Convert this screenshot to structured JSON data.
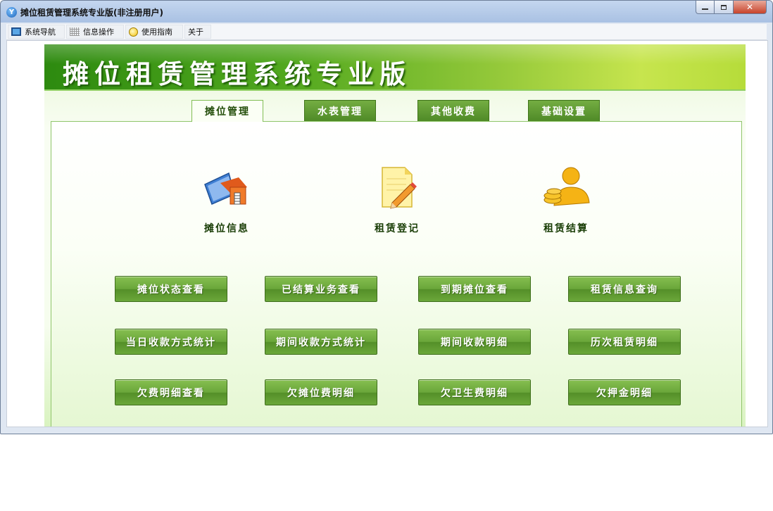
{
  "window": {
    "title": "摊位租赁管理系统专业版(非注册用户)",
    "controls": {
      "close": "✕"
    }
  },
  "menu": [
    {
      "label": "系统导航",
      "icon": "monitor-icon"
    },
    {
      "label": "信息操作",
      "icon": "grid-icon"
    },
    {
      "label": "使用指南",
      "icon": "lightbulb-icon"
    },
    {
      "label": "关于",
      "icon": ""
    }
  ],
  "banner": {
    "title": "摊位租赁管理系统专业版"
  },
  "tabs": [
    {
      "label": "摊位管理",
      "active": true
    },
    {
      "label": "水表管理",
      "active": false
    },
    {
      "label": "其他收费",
      "active": false
    },
    {
      "label": "基础设置",
      "active": false
    }
  ],
  "features": [
    {
      "label": "摊位信息",
      "icon": "house-book-icon"
    },
    {
      "label": "租赁登记",
      "icon": "notepad-pencil-icon"
    },
    {
      "label": "租赁结算",
      "icon": "person-coins-icon"
    }
  ],
  "buttons": [
    [
      "摊位状态查看",
      "已结算业务查看",
      "到期摊位查看",
      "租赁信息查询"
    ],
    [
      "当日收款方式统计",
      "期间收款方式统计",
      "期间收款明细",
      "历次租赁明细"
    ],
    [
      "欠费明细查看",
      "欠摊位费明细",
      "欠卫生费明细",
      "欠押金明细"
    ]
  ],
  "colors": {
    "brand_green": "#52a81f",
    "button_green": "#6aa63a",
    "label_dark_green": "#183c05"
  }
}
